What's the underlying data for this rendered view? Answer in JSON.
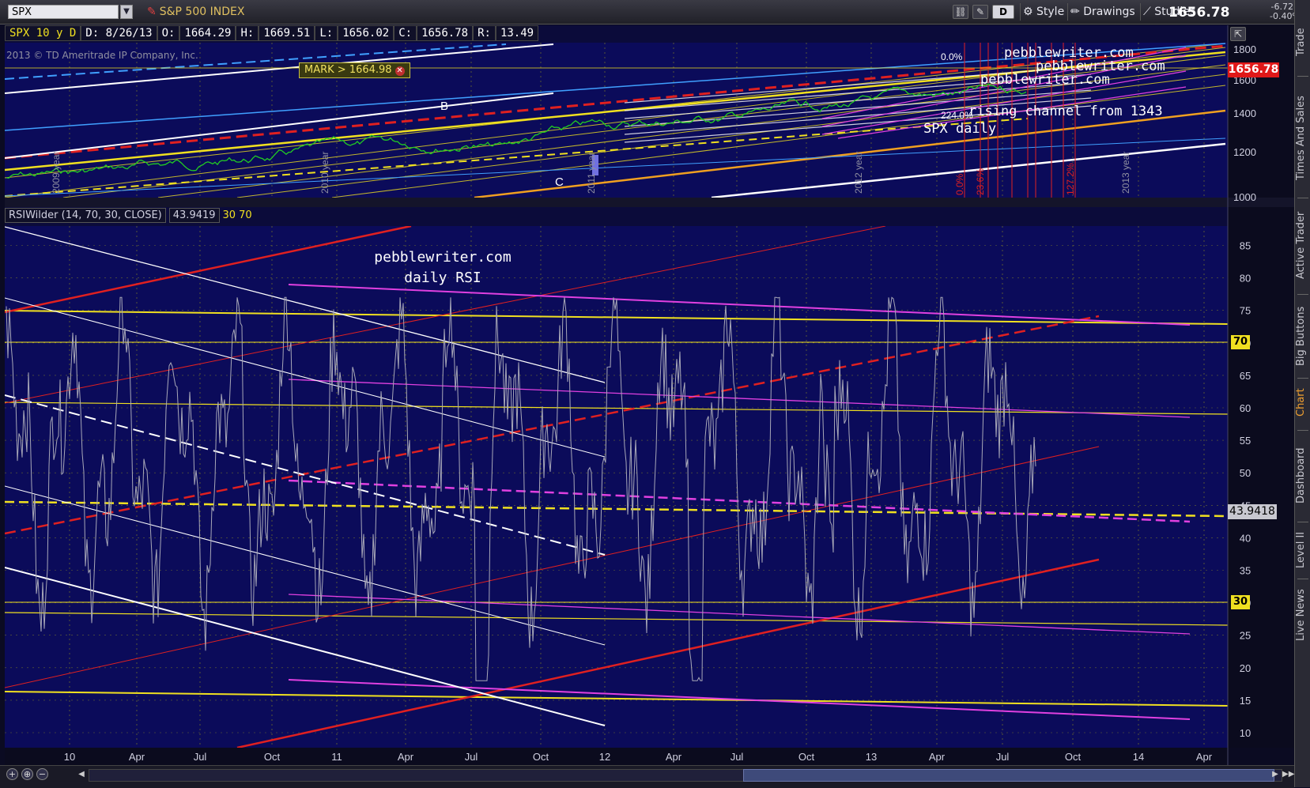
{
  "toolbar": {
    "symbol": "SPX",
    "company": "S&P 500 INDEX",
    "days_button": "D",
    "style_label": "Style",
    "drawings_label": "Drawings",
    "studies_label": "Studies",
    "last_price": "1656.78",
    "change": "-6.72",
    "change_pct": "-0.40%"
  },
  "price_info": {
    "symbol_period": "SPX 10 y D",
    "date": "D: 8/26/13",
    "open_label": "O:",
    "open": "1664.29",
    "high_label": "H:",
    "high": "1669.51",
    "low_label": "L:",
    "low": "1656.02",
    "close_label": "C:",
    "close": "1656.78",
    "range_label": "R:",
    "range": "13.49"
  },
  "copyright": "2013 © TD Ameritrade IP Company, Inc.",
  "mark_label": "MARK > 1664.98",
  "price_box": "1656.78",
  "rsi": {
    "study": "RSIWilder (14, 70, 30, CLOSE)",
    "value": "43.9419",
    "oversold": "30",
    "overbought": "70",
    "value_box": "43.9418",
    "tag_70": "70",
    "tag_30": "30",
    "title_line1": "pebblewriter.com",
    "title_line2": "daily RSI"
  },
  "annotations": {
    "B": "B",
    "C": "C",
    "pw1": "pebblewriter.com",
    "pw2": "pebblewriter.com",
    "pw3": "pebblewriter.com",
    "channel": "rising channel from 1343",
    "spx_daily": "SPX daily",
    "fib_0": "0.0%",
    "fib_23": "23.6%",
    "fib_127": "127.2%",
    "fib_top": "0.0%",
    "fib_224": "224.0%",
    "yr_a": "2009 year",
    "yr_b": "2010 year",
    "yr_c": "2011 year",
    "yr_d": "2012 year",
    "yr_e": "2013 year"
  },
  "price_axis": [
    "1800",
    "1600",
    "1400",
    "1200",
    "1000"
  ],
  "rsi_axis": [
    "85",
    "80",
    "75",
    "70",
    "65",
    "60",
    "55",
    "50",
    "45",
    "40",
    "35",
    "30",
    "25",
    "20",
    "15",
    "10"
  ],
  "time_axis": [
    "10",
    "Apr",
    "Jul",
    "Oct",
    "11",
    "Apr",
    "Jul",
    "Oct",
    "12",
    "Apr",
    "Jul",
    "Oct",
    "13",
    "Apr",
    "Jul",
    "Oct",
    "14",
    "Apr"
  ],
  "side_tabs": [
    "Trade",
    "Times And Sales",
    "Active Trader",
    "Big Buttons",
    "Chart",
    "Dashboard",
    "Level II",
    "Live News"
  ],
  "colors": {
    "background": "#0b0b5a",
    "red": "#e02020",
    "yellow": "#f0e020",
    "magenta": "#e040e0",
    "white": "#ffffff",
    "grey_rsi": "#a8a8b8"
  }
}
